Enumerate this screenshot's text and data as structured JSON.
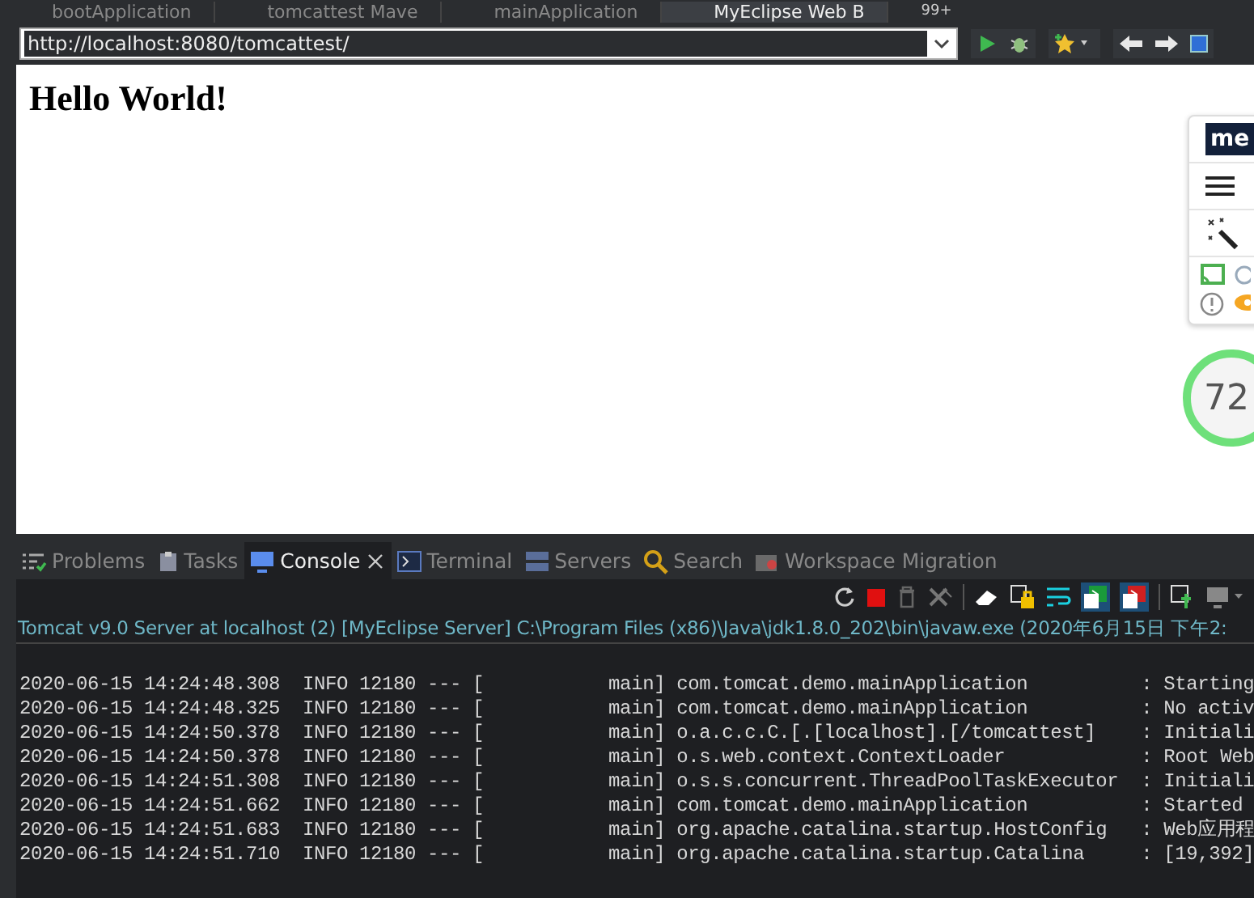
{
  "editor_tabs": [
    {
      "label": "bootApplication",
      "selected": false
    },
    {
      "label": "tomcattest Mave",
      "selected": false
    },
    {
      "label": "mainApplication",
      "selected": false
    },
    {
      "label": "MyEclipse Web B",
      "selected": true
    }
  ],
  "overflow_badge": "99+",
  "browser": {
    "url": "http://localhost:8080/tomcattest/",
    "heading": "Hello World!",
    "extension_panel": {
      "logo": "me",
      "score": "72"
    }
  },
  "panel_tabs": [
    {
      "label": "Problems",
      "selected": false
    },
    {
      "label": "Tasks",
      "selected": false
    },
    {
      "label": "Console",
      "selected": true
    },
    {
      "label": "Terminal",
      "selected": false
    },
    {
      "label": "Servers",
      "selected": false
    },
    {
      "label": "Search",
      "selected": false
    },
    {
      "label": "Workspace Migration",
      "selected": false
    }
  ],
  "console": {
    "process": "Tomcat v9.0 Server at localhost (2) [MyEclipse Server] C:\\Program Files (x86)\\Java\\jdk1.8.0_202\\bin\\javaw.exe (2020年6月15日 下午2:",
    "lines": [
      "2020-06-15 14:24:48.308  INFO 12180 --- [           main] com.tomcat.demo.mainApplication          : Starting",
      "2020-06-15 14:24:48.325  INFO 12180 --- [           main] com.tomcat.demo.mainApplication          : No activ",
      "2020-06-15 14:24:50.378  INFO 12180 --- [           main] o.a.c.c.C.[.[localhost].[/tomcattest]    : Initiali",
      "2020-06-15 14:24:50.378  INFO 12180 --- [           main] o.s.web.context.ContextLoader            : Root Web",
      "2020-06-15 14:24:51.308  INFO 12180 --- [           main] o.s.s.concurrent.ThreadPoolTaskExecutor  : Initiali",
      "2020-06-15 14:24:51.662  INFO 12180 --- [           main] com.tomcat.demo.mainApplication          : Started",
      "2020-06-15 14:24:51.683  INFO 12180 --- [           main] org.apache.catalina.startup.HostConfig   : Web应用程",
      "2020-06-15 14:24:51.710  INFO 12180 --- [           main] org.apache.catalina.startup.Catalina     : [19,392]"
    ]
  }
}
